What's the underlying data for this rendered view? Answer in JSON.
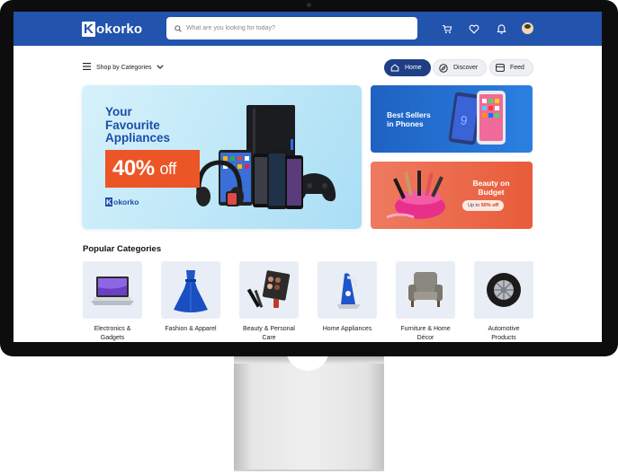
{
  "header": {
    "logo_k": "K",
    "logo_rest": "okorko",
    "search_placeholder": "What are you looking for today?",
    "icons": [
      "cart-icon",
      "heart-icon",
      "bell-icon",
      "avatar"
    ]
  },
  "subbar": {
    "shop_label": "Shop by Categories",
    "nav": [
      {
        "label": "Home",
        "icon": "home-icon",
        "active": true
      },
      {
        "label": "Discover",
        "icon": "compass-icon",
        "active": false
      },
      {
        "label": "Feed",
        "icon": "feed-icon",
        "active": false
      }
    ]
  },
  "hero": {
    "line1": "Your",
    "line2": "Favourite",
    "line3": "Appliances",
    "discount": "40%",
    "discount_suffix": "off",
    "logo_k": "K",
    "logo_rest": "okorko"
  },
  "promo_cards": [
    {
      "title_line1": "Best Sellers",
      "title_line2": "in Phones"
    },
    {
      "title_line1": "Beauty on",
      "title_line2": "Budget",
      "pill_prefix": "Up to",
      "pill_value": "50% off"
    }
  ],
  "popular": {
    "title": "Popular Categories",
    "categories": [
      {
        "line1": "Electronics &",
        "line2": "Gadgets"
      },
      {
        "line1": "Fashion & Apparel",
        "line2": ""
      },
      {
        "line1": "Beauty & Personal",
        "line2": "Care"
      },
      {
        "line1": "Home Appliances",
        "line2": ""
      },
      {
        "line1": "Furniture & Home",
        "line2": "Décor"
      },
      {
        "line1": "Automotive",
        "line2": "Products"
      }
    ]
  },
  "colors": {
    "brand_blue": "#2253ad",
    "nav_active": "#1e3f86",
    "promo_orange": "#ec5526",
    "bezel": "#0d0d0d"
  }
}
